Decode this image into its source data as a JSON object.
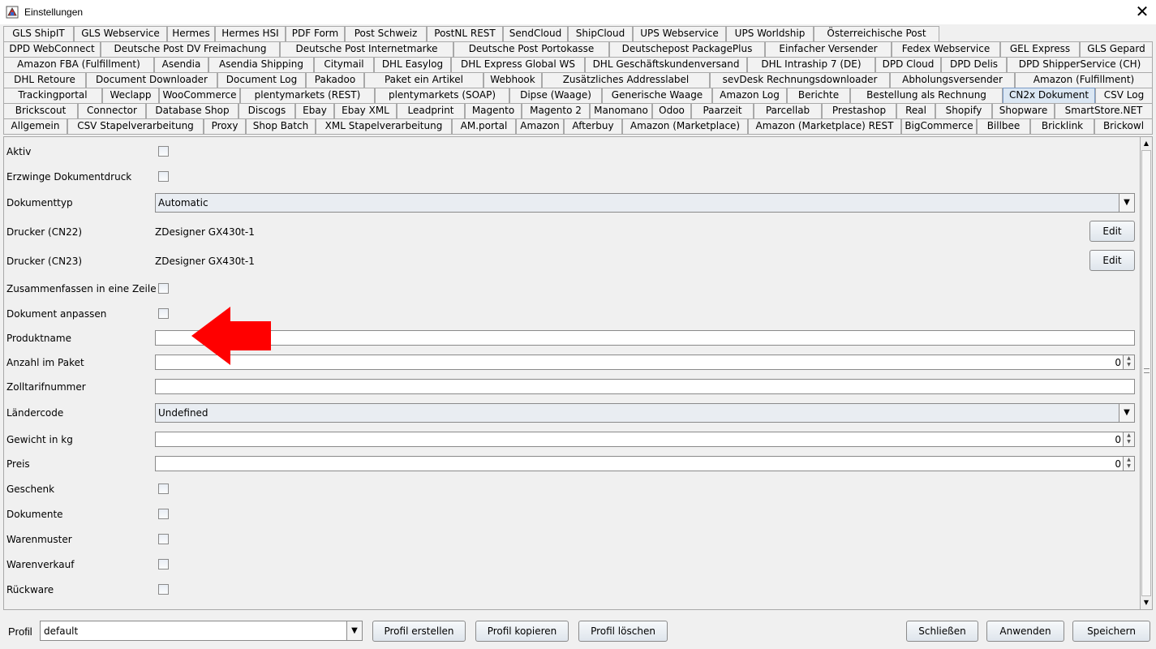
{
  "window": {
    "title": "Einstellungen",
    "close_glyph": "✕"
  },
  "tab_rows": [
    [
      "GLS ShipIT",
      "GLS Webservice",
      "Hermes",
      "Hermes HSI",
      "PDF Form",
      "Post Schweiz",
      "PostNL REST",
      "SendCloud",
      "ShipCloud",
      "UPS Webservice",
      "UPS Worldship",
      "Österreichische Post"
    ],
    [
      "DPD WebConnect",
      "Deutsche Post DV Freimachung",
      "Deutsche Post Internetmarke",
      "Deutsche Post Portokasse",
      "Deutschepost PackagePlus",
      "Einfacher Versender",
      "Fedex Webservice",
      "GEL Express",
      "GLS Gepard"
    ],
    [
      "Amazon FBA (Fulfillment)",
      "Asendia",
      "Asendia Shipping",
      "Citymail",
      "DHL Easylog",
      "DHL Express Global WS",
      "DHL Geschäftskundenversand",
      "DHL Intraship 7 (DE)",
      "DPD Cloud",
      "DPD Delis",
      "DPD ShipperService (CH)"
    ],
    [
      "DHL Retoure",
      "Document Downloader",
      "Document Log",
      "Pakadoo",
      "Paket ein Artikel",
      "Webhook",
      "Zusätzliches Addresslabel",
      "sevDesk Rechnungsdownloader",
      "Abholungsversender",
      "Amazon (Fulfillment)"
    ],
    [
      "Trackingportal",
      "Weclapp",
      "WooCommerce",
      "plentymarkets (REST)",
      "plentymarkets (SOAP)",
      "Dipse (Waage)",
      "Generische Waage",
      "Amazon Log",
      "Berichte",
      "Bestellung als Rechnung",
      "CN2x Dokument",
      "CSV Log"
    ],
    [
      "Brickscout",
      "Connector",
      "Database Shop",
      "Discogs",
      "Ebay",
      "Ebay XML",
      "Leadprint",
      "Magento",
      "Magento 2",
      "Manomano",
      "Odoo",
      "Paarzeit",
      "Parcellab",
      "Prestashop",
      "Real",
      "Shopify",
      "Shopware",
      "SmartStore.NET"
    ],
    [
      "Allgemein",
      "CSV Stapelverarbeitung",
      "Proxy",
      "Shop Batch",
      "XML Stapelverarbeitung",
      "AM.portal",
      "Amazon",
      "Afterbuy",
      "Amazon (Marketplace)",
      "Amazon (Marketplace) REST",
      "BigCommerce",
      "Billbee",
      "Bricklink",
      "Brickowl"
    ]
  ],
  "selected_tab": "CN2x Dokument",
  "form": {
    "aktiv": {
      "label": "Aktiv",
      "checked": false
    },
    "erzwinge": {
      "label": "Erzwinge Dokumentdruck",
      "checked": false
    },
    "dokumenttyp": {
      "label": "Dokumenttyp",
      "value": "Automatic"
    },
    "drucker_cn22": {
      "label": "Drucker (CN22)",
      "value": "ZDesigner GX430t-1",
      "button": "Edit"
    },
    "drucker_cn23": {
      "label": "Drucker (CN23)",
      "value": "ZDesigner GX430t-1",
      "button": "Edit"
    },
    "zusammenfassen": {
      "label": "Zusammenfassen in eine Zeile",
      "checked": false
    },
    "dokument_anpassen": {
      "label": "Dokument anpassen",
      "checked": false
    },
    "produktname": {
      "label": "Produktname",
      "value": ""
    },
    "anzahl": {
      "label": "Anzahl im Paket",
      "value": "0"
    },
    "zolltarif": {
      "label": "Zolltarifnummer",
      "value": ""
    },
    "laendercode": {
      "label": "Ländercode",
      "value": "Undefined"
    },
    "gewicht": {
      "label": "Gewicht in kg",
      "value": "0"
    },
    "preis": {
      "label": "Preis",
      "value": "0"
    },
    "geschenk": {
      "label": "Geschenk",
      "checked": false
    },
    "dokumente": {
      "label": "Dokumente",
      "checked": false
    },
    "warenmuster": {
      "label": "Warenmuster",
      "checked": false
    },
    "warenverkauf": {
      "label": "Warenverkauf",
      "checked": false
    },
    "rueckware": {
      "label": "Rückware",
      "checked": false
    }
  },
  "bottom": {
    "profil_label": "Profil",
    "profil_value": "default",
    "profil_erstellen": "Profil erstellen",
    "profil_kopieren": "Profil kopieren",
    "profil_loeschen": "Profil löschen",
    "schliessen": "Schließen",
    "anwenden": "Anwenden",
    "speichern": "Speichern"
  },
  "colors": {
    "annotation_arrow": "#ff0000",
    "selected_tab_bg": "#dbe7f3"
  },
  "icons": {
    "window": "java-app-icon",
    "dropdown": "chevron-down-icon",
    "spinner": "spinner-arrows-icon"
  }
}
